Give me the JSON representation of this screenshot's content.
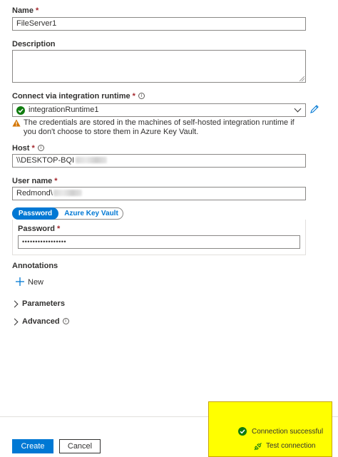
{
  "form": {
    "name_label": "Name",
    "required_mark": "*",
    "name_value": "FileServer1",
    "description_label": "Description",
    "description_value": "",
    "runtime_label": "Connect via integration runtime",
    "runtime_value": "integrationRuntime1",
    "warning_text": "The credentials are stored in the machines of self-hosted integration runtime if you don't choose to store them in Azure Key Vault.",
    "host_label": "Host",
    "host_value": "\\\\DESKTOP-BQI",
    "username_label": "User name",
    "username_value": "Redmond\\",
    "auth_tabs": [
      "Password",
      "Azure Key Vault"
    ],
    "password_label": "Password",
    "password_value": "•••••••••••••••••",
    "annotations_label": "Annotations",
    "new_label": "New",
    "parameters_label": "Parameters",
    "advanced_label": "Advanced"
  },
  "footer": {
    "create_label": "Create",
    "cancel_label": "Cancel",
    "status_text": "Connection successful",
    "test_label": "Test connection"
  },
  "colors": {
    "accent": "#0078d4",
    "success": "#107c10",
    "warning": "#d47500",
    "highlight": "#ffff00",
    "required": "#a4262c"
  }
}
